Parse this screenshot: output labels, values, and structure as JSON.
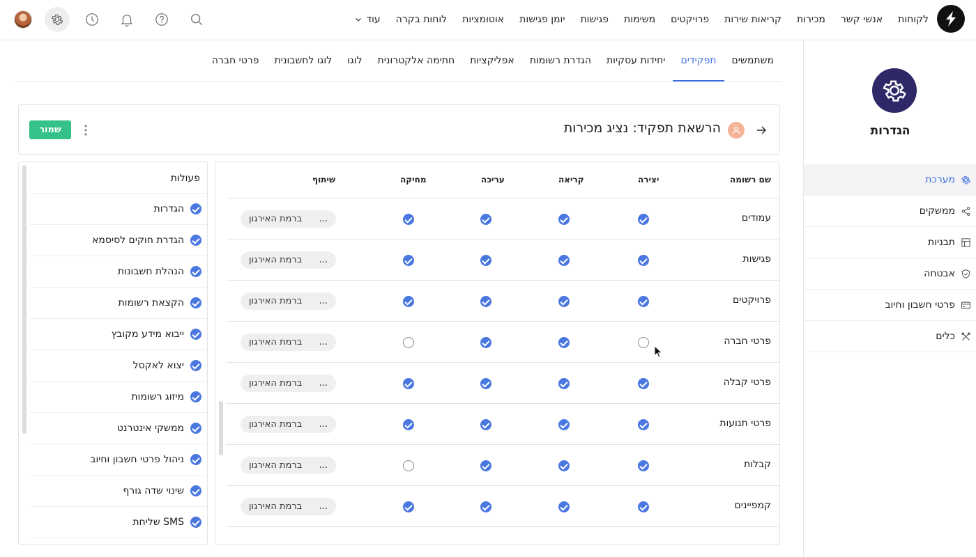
{
  "nav": {
    "items": [
      "לקוחות",
      "אנשי קשר",
      "מכירות",
      "קריאות שירות",
      "פרויקטים",
      "משימות",
      "פגישות",
      "יומן פגישות",
      "אוטומציות",
      "לוחות בקרה"
    ],
    "more_label": "עוד"
  },
  "top_icons": [
    "search-icon",
    "help-icon",
    "bell-icon",
    "clock-icon",
    "gear-icon",
    "avatar"
  ],
  "sidebar": {
    "title": "הגדרות",
    "items": [
      {
        "label": "מערכת",
        "icon": "gear-icon",
        "active": true
      },
      {
        "label": "ממשקים",
        "icon": "share-icon",
        "active": false
      },
      {
        "label": "תבניות",
        "icon": "template-icon",
        "active": false
      },
      {
        "label": "אבטחה",
        "icon": "shield-icon",
        "active": false
      },
      {
        "label": "פרטי חשבון וחיוב",
        "icon": "card-icon",
        "active": false
      },
      {
        "label": "כלים",
        "icon": "tools-icon",
        "active": false
      }
    ]
  },
  "tabs": [
    {
      "label": "משתמשים",
      "active": false
    },
    {
      "label": "תפקידים",
      "active": true
    },
    {
      "label": "יחידות עסקיות",
      "active": false
    },
    {
      "label": "הגדרת רשומות",
      "active": false
    },
    {
      "label": "אפליקציות",
      "active": false
    },
    {
      "label": "חתימה אלקטרונית",
      "active": false
    },
    {
      "label": "לוגו",
      "active": false
    },
    {
      "label": "לוגו לחשבונית",
      "active": false
    },
    {
      "label": "פרטי חברה",
      "active": false
    }
  ],
  "header": {
    "title": "הרשאת תפקיד: נציג מכירות",
    "save_label": "שמור"
  },
  "table": {
    "columns": {
      "name": "שם רשומה",
      "create": "יצירה",
      "read": "קריאה",
      "edit": "עריכה",
      "delete": "מחיקה",
      "share": "שיתוף"
    },
    "rows": [
      {
        "name": "עמודים",
        "create": true,
        "read": true,
        "edit": true,
        "delete": true,
        "share": "ברמת האירגון"
      },
      {
        "name": "פגישות",
        "create": true,
        "read": true,
        "edit": true,
        "delete": true,
        "share": "ברמת האירגון"
      },
      {
        "name": "פרויקטים",
        "create": true,
        "read": true,
        "edit": true,
        "delete": true,
        "share": "ברמת האירגון"
      },
      {
        "name": "פרטי חברה",
        "create": false,
        "read": true,
        "edit": true,
        "delete": false,
        "share": "ברמת האירגון"
      },
      {
        "name": "פרטי קבלה",
        "create": true,
        "read": true,
        "edit": true,
        "delete": true,
        "share": "ברמת האירגון"
      },
      {
        "name": "פרטי תנועות",
        "create": true,
        "read": true,
        "edit": true,
        "delete": true,
        "share": "ברמת האירגון"
      },
      {
        "name": "קבלות",
        "create": true,
        "read": true,
        "edit": true,
        "delete": false,
        "share": "ברמת האירגון"
      },
      {
        "name": "קמפיינים",
        "create": true,
        "read": true,
        "edit": true,
        "delete": true,
        "share": "ברמת האירגון"
      }
    ],
    "ellipsis": "..."
  },
  "actions": {
    "title": "פעולות",
    "items": [
      {
        "label": "הגדרות",
        "checked": true
      },
      {
        "label": "הגדרת חוקים לסיסמא",
        "checked": true
      },
      {
        "label": "הנהלת חשבונות",
        "checked": true
      },
      {
        "label": "הקצאת רשומות",
        "checked": true
      },
      {
        "label": "ייבוא מידע מקובץ",
        "checked": true
      },
      {
        "label": "יצוא לאקסל",
        "checked": true
      },
      {
        "label": "מיזוג רשומות",
        "checked": true
      },
      {
        "label": "ממשקי אינטרנט",
        "checked": true
      },
      {
        "label": "ניהול פרטי חשבון וחיוב",
        "checked": true
      },
      {
        "label": "שינוי שדה גורף",
        "checked": true
      },
      {
        "label": "שליחת SMS",
        "checked": true
      }
    ]
  },
  "colors": {
    "accent": "#3b6ee0",
    "check": "#4a78e0",
    "save": "#35c28a",
    "brand_circle": "#2e2867",
    "role_badge": "#f4b397"
  }
}
